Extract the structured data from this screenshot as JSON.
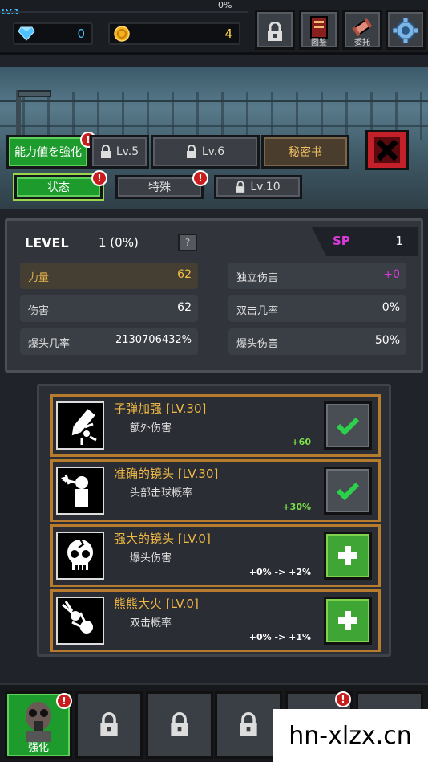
{
  "hud": {
    "player_level": "LV.1",
    "progress_pct": "0%",
    "progress_fraction": 0,
    "gems": "0",
    "gold": "4",
    "buttons": [
      {
        "icon": "lock-icon",
        "label": ""
      },
      {
        "icon": "book-icon",
        "label": "图鉴"
      },
      {
        "icon": "scroll-icon",
        "label": "委托"
      },
      {
        "icon": "gear-icon",
        "label": ""
      }
    ]
  },
  "tabs": {
    "main": [
      {
        "label": "能力値を強化",
        "active": true,
        "alert": true
      },
      {
        "label": "Lv.5",
        "locked": true
      },
      {
        "label": "Lv.6",
        "locked": true
      },
      {
        "label": "秘密书"
      }
    ],
    "sub": [
      {
        "label": "状态",
        "active": true,
        "alert": true
      },
      {
        "label": "特殊",
        "alert": true
      },
      {
        "label": "Lv.10",
        "locked": true
      }
    ]
  },
  "stats": {
    "level_label": "LEVEL",
    "level_value": "1 (0%)",
    "help_label": "?",
    "sp_label": "SP",
    "sp_value": "1",
    "items": [
      {
        "key": "力量",
        "value": "62"
      },
      {
        "key": "独立伤害",
        "value": "+0"
      },
      {
        "key": "伤害",
        "value": "62"
      },
      {
        "key": "双击几率",
        "value": "0%"
      },
      {
        "key": "爆头几率",
        "value": "2130706432%"
      },
      {
        "key": "爆头伤害",
        "value": "50%"
      }
    ]
  },
  "skills": [
    {
      "name": "子弹加强 [LV.30]",
      "desc": "额外伤害",
      "bonus": "+60",
      "state": "done",
      "icon": "bullet-icon"
    },
    {
      "name": "准确的镜头 [LV.30]",
      "desc": "头部击球概率",
      "bonus": "+30%",
      "state": "done",
      "icon": "headshot-icon"
    },
    {
      "name": "强大的镜头 [LV.0]",
      "desc": "爆头伤害",
      "bonus": "+0% -> +2%",
      "state": "plus",
      "icon": "skull-icon"
    },
    {
      "name": "熊熊大火 [LV.0]",
      "desc": "双击概率",
      "bonus": "+0% -> +1%",
      "state": "plus",
      "icon": "fireball-icon"
    }
  ],
  "bottom_bar": {
    "slots": [
      {
        "label": "强化",
        "active": true,
        "alert": true
      },
      {
        "label": "",
        "locked": true
      },
      {
        "label": "",
        "locked": true
      },
      {
        "label": "",
        "locked": true
      },
      {
        "label": "",
        "locked": true,
        "alert": true
      }
    ]
  },
  "watermark": "hn-xlzx.cn",
  "colors": {
    "accent_green": "#1d9b2c",
    "alert_red": "#c91c1c",
    "skill_gold": "#f0b844",
    "sp_magenta": "#d93bd9"
  }
}
